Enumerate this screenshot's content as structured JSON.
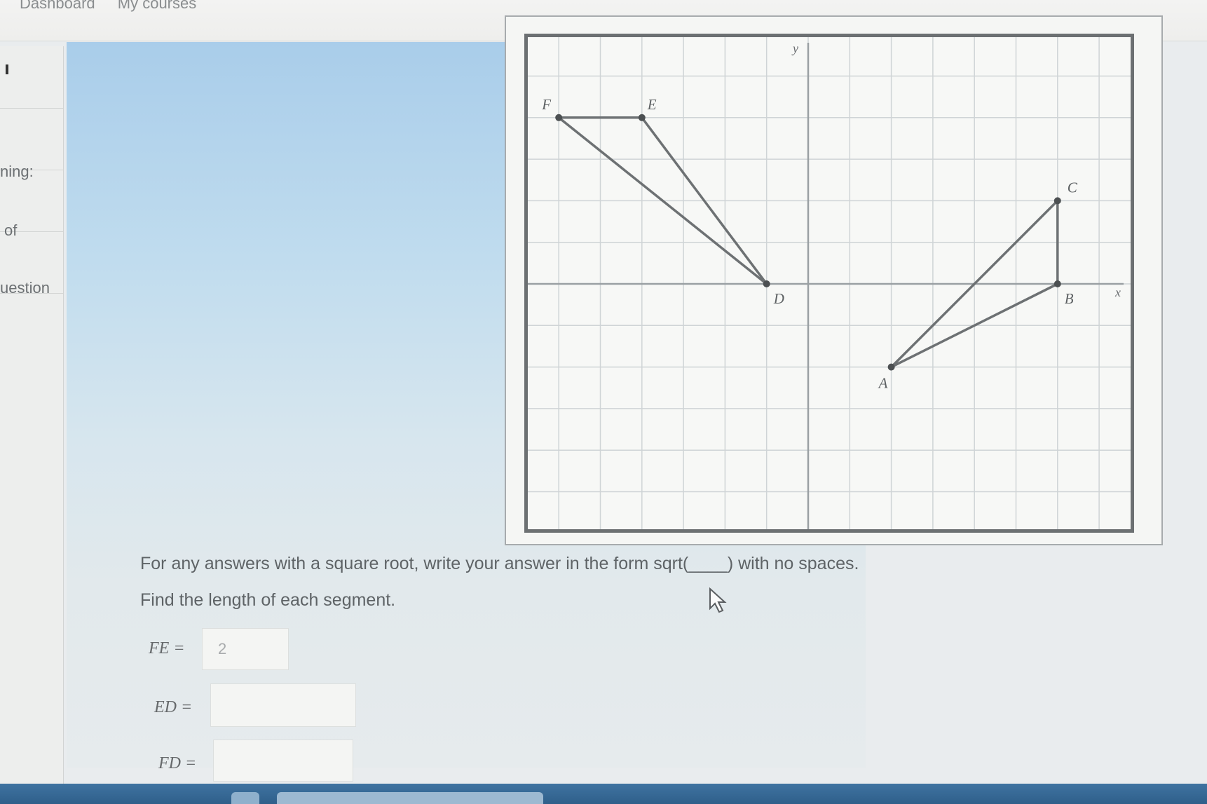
{
  "topbar": {
    "nav_items": [
      "Dashboard",
      "My courses"
    ]
  },
  "sidebar": {
    "items": [
      {
        "label": ""
      },
      {
        "label": "ning:"
      },
      {
        "label": "of"
      },
      {
        "label": "uestion"
      }
    ]
  },
  "graph": {
    "axis_x_label": "x",
    "axis_y_label": "y",
    "points": [
      {
        "name": "F",
        "x": -6,
        "y": 4
      },
      {
        "name": "E",
        "x": -4,
        "y": 4
      },
      {
        "name": "D",
        "x": -1,
        "y": 0
      },
      {
        "name": "C",
        "x": 6,
        "y": 2
      },
      {
        "name": "B",
        "x": 6,
        "y": 0
      },
      {
        "name": "A",
        "x": 2,
        "y": -2
      }
    ],
    "segments": [
      [
        "F",
        "E"
      ],
      [
        "E",
        "D"
      ],
      [
        "F",
        "D"
      ],
      [
        "C",
        "B"
      ],
      [
        "B",
        "A"
      ],
      [
        "C",
        "A"
      ]
    ]
  },
  "question": {
    "instruction": "For any answers with a square root, write your answer in the form sqrt(____) with no spaces.",
    "prompt": "Find the length of each segment.",
    "fields": [
      {
        "label": "FE =",
        "value": "2"
      },
      {
        "label": "ED =",
        "value": ""
      },
      {
        "label": "FD =",
        "value": ""
      }
    ]
  }
}
